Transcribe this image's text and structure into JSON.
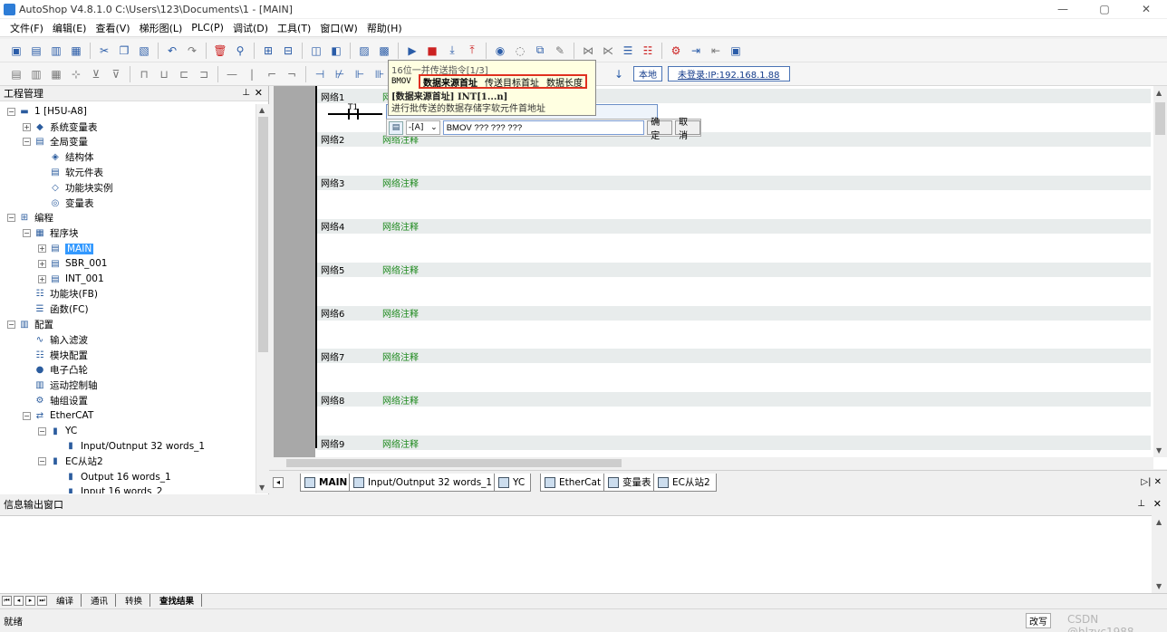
{
  "titlebar": {
    "title": "AutoShop V4.8.1.0  C:\\Users\\123\\Documents\\1 - [MAIN]",
    "minimize": "—",
    "maximize": "▢",
    "close": "✕"
  },
  "menu": [
    "文件(F)",
    "编辑(E)",
    "查看(V)",
    "梯形图(L)",
    "PLC(P)",
    "调试(D)",
    "工具(T)",
    "窗口(W)",
    "帮助(H)"
  ],
  "toolbar2": {
    "local_label": "本地",
    "login_label": "未登录:IP:192.168.1.88"
  },
  "project_panel": {
    "title": "工程管理",
    "tree": [
      {
        "label": "1 [H5U-A8]",
        "indent": 0,
        "exp": "−",
        "icon": "plc-icon"
      },
      {
        "label": "系统变量表",
        "indent": 1,
        "exp": "+",
        "icon": "system-variable-icon"
      },
      {
        "label": "全局变量",
        "indent": 1,
        "exp": "−",
        "icon": "global-variable-icon"
      },
      {
        "label": "结构体",
        "indent": 2,
        "exp": "",
        "icon": "struct-icon"
      },
      {
        "label": "软元件表",
        "indent": 2,
        "exp": "",
        "icon": "device-table-icon"
      },
      {
        "label": "功能块实例",
        "indent": 2,
        "exp": "",
        "icon": "fb-instance-icon"
      },
      {
        "label": "变量表",
        "indent": 2,
        "exp": "",
        "icon": "variable-table-icon"
      },
      {
        "label": "编程",
        "indent": 0,
        "exp": "−",
        "icon": "programming-icon"
      },
      {
        "label": "程序块",
        "indent": 1,
        "exp": "−",
        "icon": "program-block-icon"
      },
      {
        "label": "MAIN",
        "indent": 2,
        "exp": "+",
        "icon": "ladder-file-icon",
        "selected": true
      },
      {
        "label": "SBR_001",
        "indent": 2,
        "exp": "+",
        "icon": "subroutine-icon"
      },
      {
        "label": "INT_001",
        "indent": 2,
        "exp": "+",
        "icon": "interrupt-icon"
      },
      {
        "label": "功能块(FB)",
        "indent": 1,
        "exp": "",
        "icon": "function-block-icon"
      },
      {
        "label": "函数(FC)",
        "indent": 1,
        "exp": "",
        "icon": "function-icon"
      },
      {
        "label": "配置",
        "indent": 0,
        "exp": "−",
        "icon": "config-icon"
      },
      {
        "label": "输入滤波",
        "indent": 1,
        "exp": "",
        "icon": "input-filter-icon"
      },
      {
        "label": "模块配置",
        "indent": 1,
        "exp": "",
        "icon": "module-config-icon"
      },
      {
        "label": "电子凸轮",
        "indent": 1,
        "exp": "",
        "icon": "cam-icon"
      },
      {
        "label": "运动控制轴",
        "indent": 1,
        "exp": "",
        "icon": "motion-axis-icon"
      },
      {
        "label": "轴组设置",
        "indent": 1,
        "exp": "",
        "icon": "axis-group-icon"
      },
      {
        "label": "EtherCAT",
        "indent": 1,
        "exp": "−",
        "icon": "ethercat-icon"
      },
      {
        "label": "YC",
        "indent": 2,
        "exp": "−",
        "icon": "slave-icon"
      },
      {
        "label": "Input/Outnput 32 words_1",
        "indent": 3,
        "exp": "",
        "icon": "io-module-icon"
      },
      {
        "label": "EC从站2",
        "indent": 2,
        "exp": "−",
        "icon": "slave-icon"
      },
      {
        "label": "Output 16 words_1",
        "indent": 3,
        "exp": "",
        "icon": "io-module-icon"
      },
      {
        "label": "Input 16 words_2",
        "indent": 3,
        "exp": "",
        "icon": "io-module-icon"
      }
    ]
  },
  "editor": {
    "networks": [
      {
        "name": "网络1",
        "comment": "网络注释"
      },
      {
        "name": "网络2",
        "comment": "网络注释"
      },
      {
        "name": "网络3",
        "comment": "网络注释"
      },
      {
        "name": "网络4",
        "comment": "网络注释"
      },
      {
        "name": "网络5",
        "comment": "网络注释"
      },
      {
        "name": "网络6",
        "comment": "网络注释"
      },
      {
        "name": "网络7",
        "comment": "网络注释"
      },
      {
        "name": "网络8",
        "comment": "网络注释"
      },
      {
        "name": "网络9",
        "comment": "网络注释"
      }
    ],
    "contact_label": "T1",
    "instruction_box": "BMOV    ???       ???       ???"
  },
  "tooltip": {
    "line1": "16位一并传送指令[1/3]",
    "mnemonic": "BMOV",
    "param1": "数据来源首址",
    "param2": "传送目标首址",
    "param3": "数据长度",
    "type_line": "[数据来源首址] INT[1...n]",
    "desc": "进行批传送的数据存储字软元件首地址"
  },
  "inputbar": {
    "mode": "-[A]",
    "value": "BMOV ??? ??? ???",
    "ok": "确定",
    "cancel": "取消"
  },
  "tabs": [
    {
      "label": "MAIN",
      "active": true
    },
    {
      "label": "Input/Outnput 32 words_1",
      "active": false
    },
    {
      "label": "YC",
      "active": false
    },
    {
      "label": "EtherCat",
      "active": false
    },
    {
      "label": "变量表",
      "active": false
    },
    {
      "label": "EC从站2",
      "active": false
    }
  ],
  "output": {
    "title": "信息输出窗口",
    "tabs": [
      "编译",
      "通讯",
      "转换",
      "查找结果"
    ],
    "active_tab": "查找结果"
  },
  "status": {
    "text": "就绪",
    "mode": "改写",
    "watermark": "CSDN @hlzyc1988"
  }
}
